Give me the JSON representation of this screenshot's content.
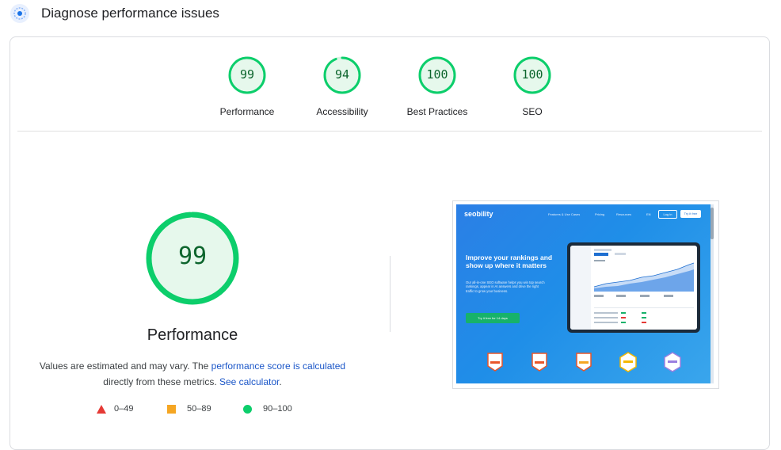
{
  "header": {
    "title": "Diagnose performance issues",
    "icon": "performance-dot-icon"
  },
  "colors": {
    "pass": "#0cce6b",
    "pass_fill": "#e6f8ec",
    "pass_text": "#0d652d",
    "average": "#f5a623",
    "fail": "#e53935",
    "link": "#1a56c8"
  },
  "categories": [
    {
      "label": "Performance",
      "score": "99",
      "value": 99
    },
    {
      "label": "Accessibility",
      "score": "94",
      "value": 94
    },
    {
      "label": "Best Practices",
      "score": "100",
      "value": 100
    },
    {
      "label": "SEO",
      "score": "100",
      "value": 100
    }
  ],
  "main": {
    "score": "99",
    "value": 99,
    "title": "Performance",
    "note_prefix": "Values are estimated and may vary. The ",
    "note_link": "performance score is calculated",
    "note_middle": "directly from these metrics. ",
    "note_link2": "See calculator",
    "note_suffix": "."
  },
  "legend": [
    {
      "shape": "triangle",
      "range": "0–49"
    },
    {
      "shape": "square",
      "range": "50–89"
    },
    {
      "shape": "circle",
      "range": "90–100"
    }
  ],
  "screenshot": {
    "logo": "seobility",
    "nav": [
      "Features & Use Cases",
      "Pricing",
      "Resources",
      "EN"
    ],
    "login": "Log in",
    "trial": "Try it free",
    "headline": "Improve your rankings and show up where it matters",
    "body": "Our all-in-one SEO software helps you win top search rankings, appear in AI answers and drive the right traffic to grow your business.",
    "cta": "Try it free for 14 days",
    "badges": [
      "High Performer",
      "High Performer",
      "Grid Leader",
      "Leader",
      "Leader"
    ]
  }
}
